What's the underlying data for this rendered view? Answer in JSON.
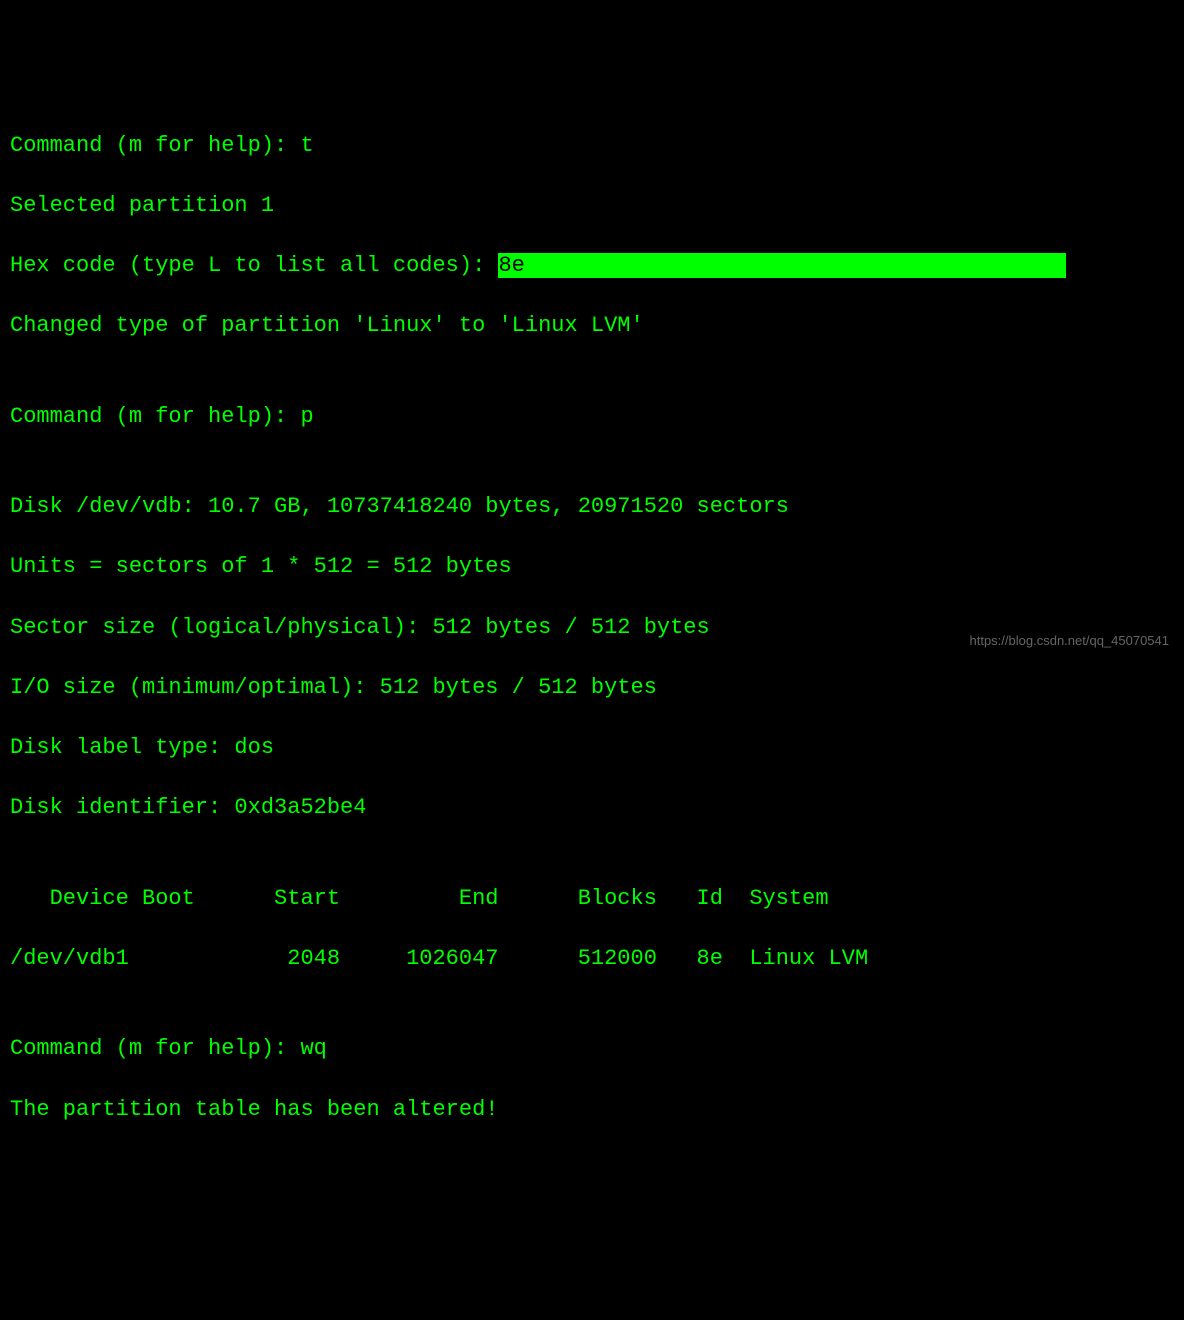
{
  "lines": {
    "l1_prompt": "Command (m for help): ",
    "l1_input": "t",
    "l2": "Selected partition 1",
    "l3_prompt": "Hex code (type L to list all codes): ",
    "l3_input": "8e",
    "l3_pad": "                                         ",
    "l4": "Changed type of partition 'Linux' to 'Linux LVM'",
    "blank": "",
    "l6_prompt": "Command (m for help): ",
    "l6_input": "p",
    "l8": "Disk /dev/vdb: 10.7 GB, 10737418240 bytes, 20971520 sectors",
    "l9": "Units = sectors of 1 * 512 = 512 bytes",
    "l10": "Sector size (logical/physical): 512 bytes / 512 bytes",
    "l11": "I/O size (minimum/optimal): 512 bytes / 512 bytes",
    "l12": "Disk label type: dos",
    "l13": "Disk identifier: 0xd3a52be4",
    "header": "   Device Boot      Start         End      Blocks   Id  System",
    "row": "/dev/vdb1            2048     1026047      512000   8e  Linux LVM",
    "l17_prompt": "Command (m for help): ",
    "l17_input": "wq",
    "l18": "The partition table has been altered!"
  },
  "watermark": "https://blog.csdn.net/qq_45070541"
}
